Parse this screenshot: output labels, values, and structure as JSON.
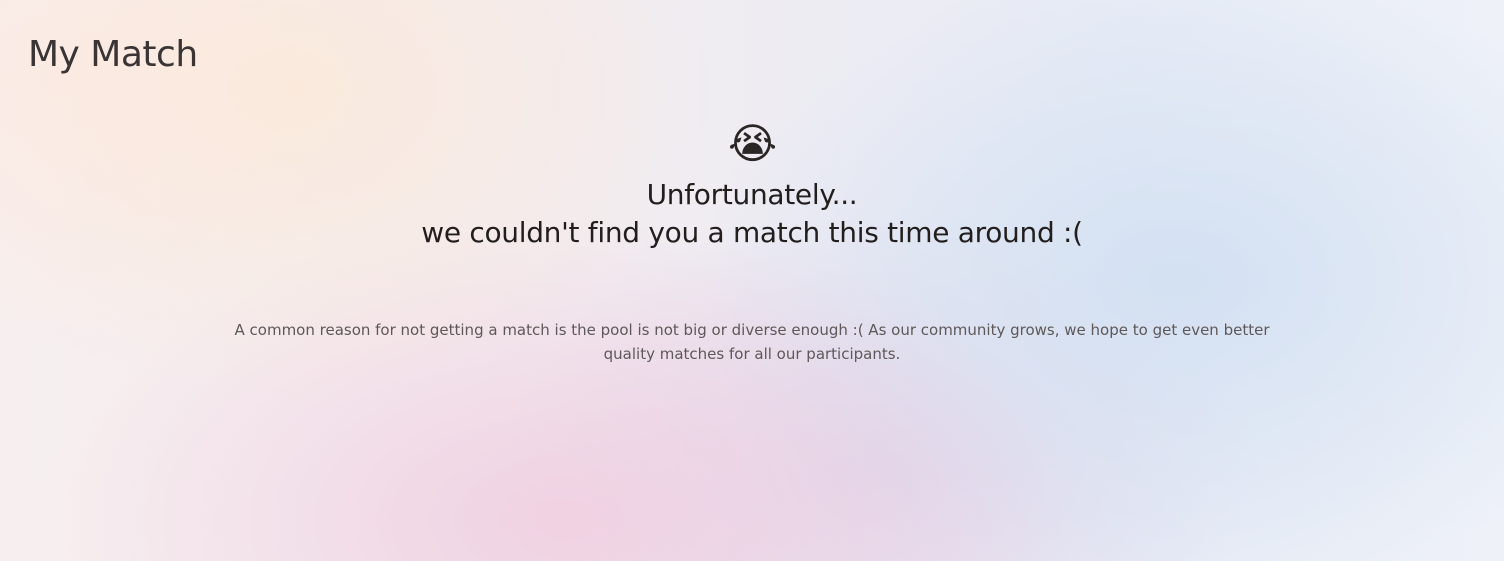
{
  "page": {
    "title": "My Match"
  },
  "message": {
    "icon": "loudly-crying-face-emoji",
    "emoji": "😭",
    "headline_line1": "Unfortunately...",
    "headline_line2": "we couldn't find you a match this time around :(",
    "reason": "A common reason for not getting a match is the pool is not big or diverse enough :( As our community grows, we hope to get even better quality matches for all our participants."
  },
  "colors": {
    "title_text": "#3a3434",
    "headline_text": "#231e1e",
    "body_text": "#5e5858",
    "bg_peach": "#fce8d6",
    "bg_pink": "#f0cde0",
    "bg_blue": "#d2e0f2"
  }
}
